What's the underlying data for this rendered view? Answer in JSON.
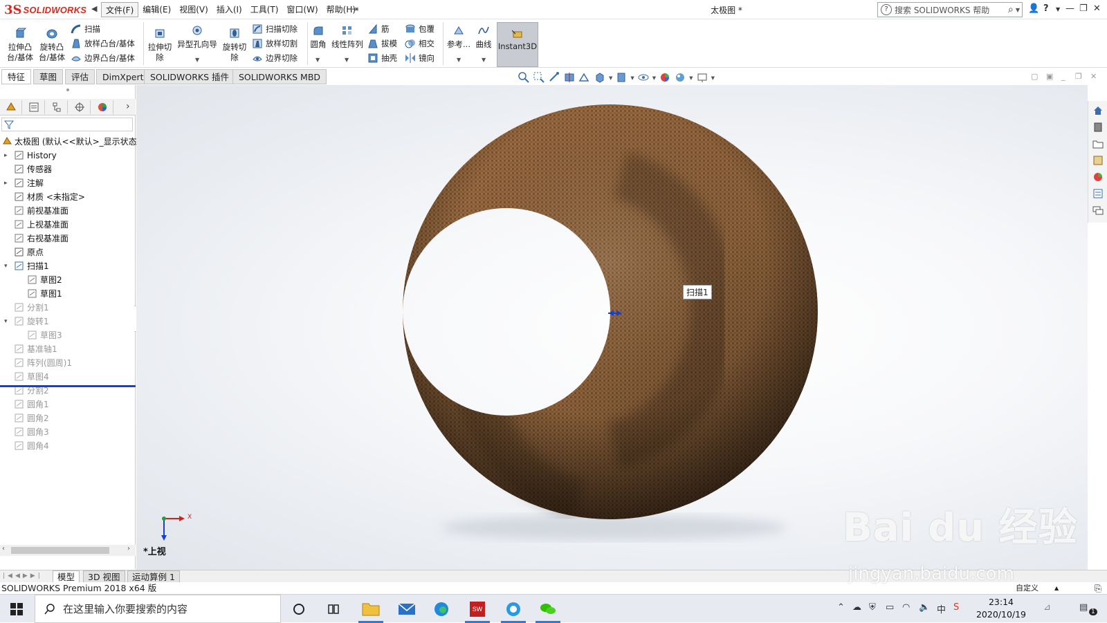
{
  "app": {
    "logo_ds": "3S",
    "logo_name": "SOLIDWORKS",
    "document_title": "太极图 *",
    "help_search_placeholder": "搜索 SOLIDWORKS 帮助"
  },
  "menu": [
    "文件(F)",
    "编辑(E)",
    "视图(V)",
    "插入(I)",
    "工具(T)",
    "窗口(W)",
    "帮助(H)"
  ],
  "commands": {
    "extrude_boss": "拉伸凸\n台/基体",
    "revolve_boss": "旋转凸\n台/基体",
    "sweep": "扫描",
    "loft_boss": "放样凸台/基体",
    "boundary_boss": "边界凸台/基体",
    "extrude_cut": "拉伸切\n除",
    "hole_wizard": "异型孔向导",
    "revolve_cut": "旋转切\n除",
    "sweep_cut": "扫描切除",
    "loft_cut": "放样切割",
    "boundary_cut": "边界切除",
    "fillet": "圆角",
    "linear_pattern": "线性阵列",
    "rib": "筋",
    "draft": "拔模",
    "shell": "抽壳",
    "wrap": "包覆",
    "intersect": "相交",
    "mirror": "镜向",
    "reference": "参考...",
    "curves": "曲线",
    "instant3d": "Instant3D"
  },
  "tabs": [
    "特征",
    "草图",
    "评估",
    "DimXpert",
    "SOLIDWORKS 插件",
    "SOLIDWORKS MBD"
  ],
  "tree": {
    "root": "太极图 (默认<<默认>_显示状态",
    "items": [
      {
        "label": "History",
        "grey": false
      },
      {
        "label": "传感器",
        "grey": false
      },
      {
        "label": "注解",
        "grey": false
      },
      {
        "label": "材质 <未指定>",
        "grey": false
      },
      {
        "label": "前视基准面",
        "grey": false
      },
      {
        "label": "上视基准面",
        "grey": false
      },
      {
        "label": "右视基准面",
        "grey": false
      },
      {
        "label": "原点",
        "grey": false
      },
      {
        "label": "扫描1",
        "grey": false
      },
      {
        "label": "草图2",
        "grey": false
      },
      {
        "label": "草图1",
        "grey": false
      },
      {
        "label": "分割1",
        "grey": true
      },
      {
        "label": "旋转1",
        "grey": true
      },
      {
        "label": "草图3",
        "grey": true
      },
      {
        "label": "基准轴1",
        "grey": true
      },
      {
        "label": "阵列(圆周)1",
        "grey": true
      },
      {
        "label": "草图4",
        "grey": true
      },
      {
        "label": "分割2",
        "grey": true
      },
      {
        "label": "圆角1",
        "grey": true
      },
      {
        "label": "圆角2",
        "grey": true
      },
      {
        "label": "圆角3",
        "grey": true
      },
      {
        "label": "圆角4",
        "grey": true
      }
    ]
  },
  "viewport": {
    "tooltip": "扫描1",
    "view_label": "*上视",
    "triad_x": "X"
  },
  "bottom_tabs": [
    "模型",
    "3D 视图",
    "运动算例 1"
  ],
  "status": {
    "product": "SOLIDWORKS Premium 2018 x64 版",
    "right": "自定义"
  },
  "taskbar": {
    "search_placeholder": "在这里输入你要搜索的内容",
    "time": "23:14",
    "date": "2020/10/19",
    "ime": "中",
    "notif_count": "1"
  },
  "watermark": {
    "line1": "Bai du 经验",
    "line2": "jingyan.baidu.com"
  },
  "colors": {
    "brand_red": "#d52b1e",
    "rollback_bar": "#1e40c8",
    "part_brown": "#8a5f38"
  }
}
